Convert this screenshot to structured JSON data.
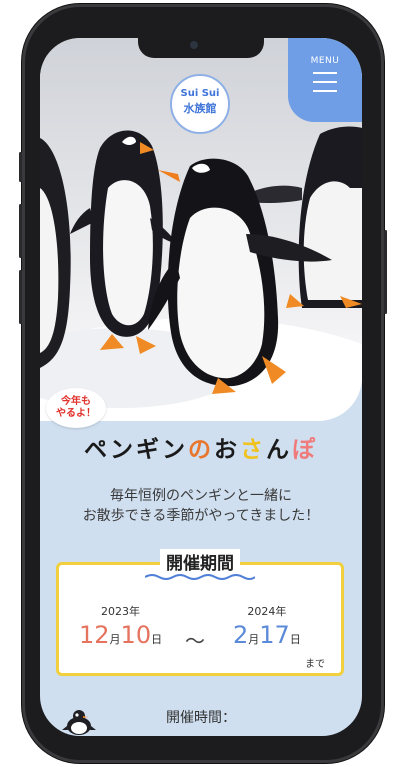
{
  "header": {
    "menu_label": "MENU",
    "logo_line1": "Sui Sui",
    "logo_line2": "水族館"
  },
  "badge": {
    "line1": "今年も",
    "line2": "やるよ！"
  },
  "title": {
    "part1": "ペンギン",
    "part2": "の",
    "part3": "お",
    "part4": "さ",
    "part5": "ん",
    "part6": "ぽ"
  },
  "description": {
    "line1": "毎年恒例のペンギンと一緒に",
    "line2": "お散歩できる季節がやってきました！"
  },
  "period": {
    "heading": "開催期間",
    "start": {
      "year": "2023年",
      "month": "12",
      "month_unit": "月",
      "day": "10",
      "day_unit": "日"
    },
    "separator": "〜",
    "end": {
      "year": "2024年",
      "month": "2",
      "month_unit": "月",
      "day": "17",
      "day_unit": "日"
    },
    "until": "まで"
  },
  "hours": {
    "label": "開催時間："
  },
  "colors": {
    "menu_bg": "#6f9ee6",
    "page_bg": "#cfdff0",
    "frame": "#f2cf3c",
    "start_date": "#e5735e",
    "end_date": "#5b8ad8",
    "badge_text": "#e0302a"
  }
}
